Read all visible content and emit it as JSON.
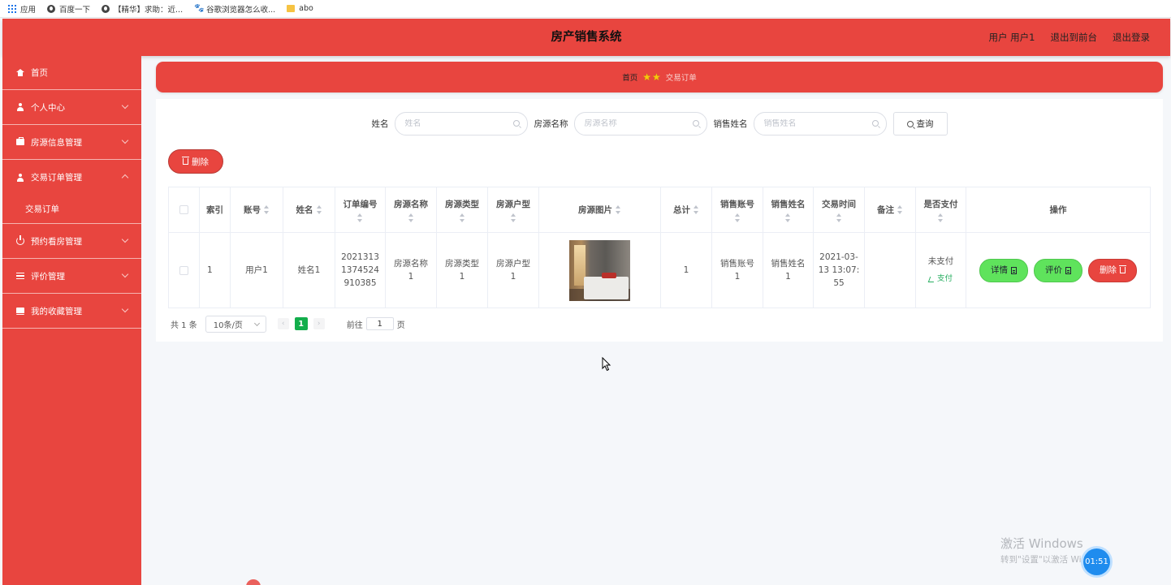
{
  "bookmarks": [
    {
      "label": "应用",
      "icon": "apps-grid-icon"
    },
    {
      "label": "百度一下",
      "icon": "globe-icon"
    },
    {
      "label": "【精华】求助：近...",
      "icon": "globe-icon"
    },
    {
      "label": "谷歌浏览器怎么收...",
      "icon": "baidu-paw-icon"
    },
    {
      "label": "abo",
      "icon": "folder-icon"
    }
  ],
  "header": {
    "title": "房产销售系统",
    "user_label": "用户 用户1",
    "to_front": "退出到前台",
    "logout": "退出登录"
  },
  "sidebar": {
    "home": "首页",
    "items": [
      {
        "label": "个人中心",
        "icon": "user-icon"
      },
      {
        "label": "房源信息管理",
        "icon": "briefcase-icon"
      },
      {
        "label": "交易订单管理",
        "icon": "user-icon",
        "expanded": true
      },
      {
        "label": "预约看房管理",
        "icon": "power-icon"
      },
      {
        "label": "评价管理",
        "icon": "list-icon"
      },
      {
        "label": "我的收藏管理",
        "icon": "book-icon"
      }
    ],
    "sub_item": "交易订单"
  },
  "breadcrumb": {
    "home": "首页",
    "current": "交易订单"
  },
  "search": {
    "name_label": "姓名",
    "name_placeholder": "姓名",
    "house_label": "房源名称",
    "house_placeholder": "房源名称",
    "seller_label": "销售姓名",
    "seller_placeholder": "销售姓名",
    "query_button": "查询"
  },
  "toolbar": {
    "delete_button": "删除"
  },
  "table": {
    "headers": {
      "index": "索引",
      "account": "账号",
      "name": "姓名",
      "order_no": "订单编号",
      "house_name": "房源名称",
      "house_type": "房源类型",
      "house_layout": "房源户型",
      "house_image": "房源图片",
      "total": "总计",
      "seller_account": "销售账号",
      "seller_name": "销售姓名",
      "trade_time": "交易时间",
      "remark": "备注",
      "paid": "是否支付",
      "actions": "操作"
    },
    "rows": [
      {
        "index": "1",
        "account": "用户1",
        "name": "姓名1",
        "order_no": "20213131374524910385",
        "order_no_lines": [
          "2021313",
          "1374524",
          "910385"
        ],
        "house_name_lines": [
          "房源名称",
          "1"
        ],
        "house_type_lines": [
          "房源类型",
          "1"
        ],
        "house_layout_lines": [
          "房源户型",
          "1"
        ],
        "total": "1",
        "seller_account_lines": [
          "销售账号",
          "1"
        ],
        "seller_name_lines": [
          "销售姓名",
          "1"
        ],
        "trade_time_lines": [
          "2021-03-",
          "13 13:07:",
          "55"
        ],
        "remark": "",
        "paid_status": "未支付",
        "pay_link": "支付",
        "btn_detail": "详情",
        "btn_review": "评价",
        "btn_delete": "删除"
      }
    ]
  },
  "pagination": {
    "total_text": "共 1 条",
    "page_size": "10条/页",
    "current_page": "1",
    "goto_prefix": "前往",
    "goto_value": "1",
    "goto_suffix": "页"
  },
  "watermark": {
    "line1": "激活 Windows",
    "line2": "转到\"设置\"以激活 Windows。"
  },
  "timer": "01:51",
  "colors": {
    "primary": "#e8453f",
    "green_button": "#5fe35c",
    "pager_active": "#13ae4c",
    "pay_link": "#27ae60"
  }
}
